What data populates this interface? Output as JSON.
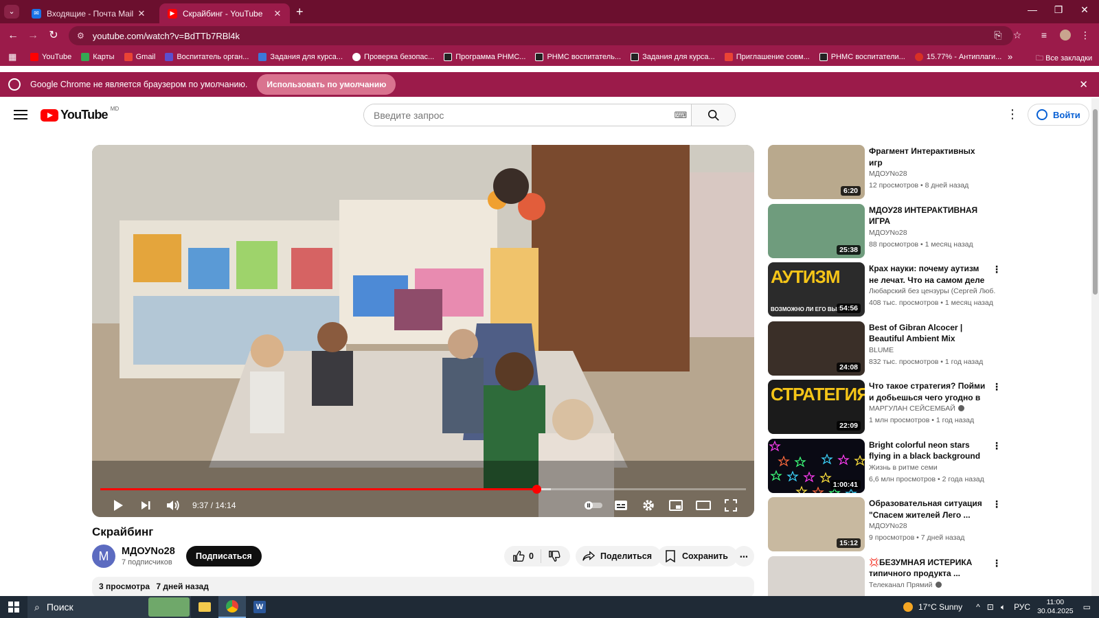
{
  "browser": {
    "tabs": [
      {
        "title": "Входящие - Почта Mail",
        "icon": "mail-icon",
        "active": false
      },
      {
        "title": "Скрайбинг - YouTube",
        "icon": "youtube-icon",
        "active": true
      }
    ],
    "url": "youtube.com/watch?v=BdTTb7RBl4k",
    "bookmarks": [
      {
        "label": "YouTube",
        "color": "#ff0000"
      },
      {
        "label": "Карты",
        "color": "#34a853"
      },
      {
        "label": "Gmail",
        "color": "#ea4335"
      },
      {
        "label": "Воспитатель орган...",
        "color": "#5b4fcf"
      },
      {
        "label": "Задания для курса...",
        "color": "#3c78d8"
      },
      {
        "label": "Проверка безопас...",
        "color": "#ffffff"
      },
      {
        "label": "Программа PHMC...",
        "color": "#222222"
      },
      {
        "label": "PHMC воспитатель...",
        "color": "#222222"
      },
      {
        "label": "Задания для курса...",
        "color": "#222222"
      },
      {
        "label": "Приглашение совм...",
        "color": "#ea4335"
      },
      {
        "label": "PHMC воспитатели...",
        "color": "#222222"
      },
      {
        "label": "15.77% - Антиплаги...",
        "color": "#d93025"
      }
    ],
    "bookmarks_all": "Все закладки",
    "infobar": {
      "text": "Google Chrome не является браузером по умолчанию.",
      "button": "Использовать по умолчанию"
    }
  },
  "youtube": {
    "logo_text": "YouTube",
    "logo_region": "MD",
    "search_placeholder": "Введите запрос",
    "signin_label": "Войти",
    "player": {
      "time": "9:37 / 14:14",
      "progress_played": 0.676,
      "progress_buffered": 0.698
    },
    "video": {
      "title": "Скрайбинг",
      "channel": "МДОУNo28",
      "channel_initial": "M",
      "subscribers": "7 подписчиков",
      "subscribe_label": "Подписаться",
      "likes": "0",
      "share_label": "Поделиться",
      "save_label": "Сохранить",
      "views": "3 просмотра",
      "date": "7 дней назад"
    },
    "recommendations": [
      {
        "title": "Фрагмент Интерактивных игр",
        "channel": "МДОУNo28",
        "meta": "12 просмотров • 8 дней назад",
        "duration": "6:20",
        "verified": false,
        "menu": false,
        "thumb": "#b9a98d"
      },
      {
        "title": "МДОУ28 ИНТЕРАКТИВНАЯ ИГРА",
        "channel": "МДОУNo28",
        "meta": "88 просмотров • 1 месяц назад",
        "duration": "25:38",
        "verified": false,
        "menu": false,
        "thumb": "#6f9c7d"
      },
      {
        "title": "Крах науки: почему аутизм не лечат. Что на самом деле ...",
        "channel": "Любарский без цензуры (Сергей Люб...",
        "meta": "408 тыс. просмотров • 1 месяц назад",
        "duration": "54:56",
        "verified": false,
        "menu": true,
        "thumb": "#2b2b2b",
        "overlay": "АУТИЗМ",
        "overlay_sub": "ВОЗМОЖНО ЛИ ЕГО ВЫЛ"
      },
      {
        "title": "Best of Gibran Alcocer | Beautiful Ambient Mix",
        "channel": "BLUME",
        "meta": "832 тыс. просмотров • 1 год назад",
        "duration": "24:08",
        "verified": false,
        "menu": false,
        "thumb": "#3a2f28"
      },
      {
        "title": "Что такое стратегия? Пойми и добьешься чего угодно в ...",
        "channel": "МАРГУЛАН СЕЙСЕМБАЙ",
        "meta": "1 млн просмотров • 1 год назад",
        "duration": "22:09",
        "verified": true,
        "menu": true,
        "thumb": "#1b1b1b",
        "overlay": "СТРАТЕГИЯ",
        "overlay_sub": ""
      },
      {
        "title": "Bright colorful neon stars flying in a black background",
        "channel": "Жизнь в ритме семи",
        "meta": "6,6 млн просмотров • 2 года назад",
        "duration": "1:00:41",
        "verified": false,
        "menu": true,
        "thumb": "#0a0a14"
      },
      {
        "title": "Образовательная ситуация \"Спасем жителей Лего ...",
        "channel": "МДОУNo28",
        "meta": "9 просмотров • 7 дней назад",
        "duration": "15:12",
        "verified": false,
        "menu": true,
        "thumb": "#c8b9a0"
      },
      {
        "title": "💢БЕЗУМНАЯ ИСТЕРИКА типичного продукта ...",
        "channel": "Телеканал Прямий",
        "meta": "",
        "duration": "",
        "verified": true,
        "menu": true,
        "thumb": "#d9d4cf"
      }
    ]
  },
  "taskbar": {
    "search_label": "Поиск",
    "weather": "17°C  Sunny",
    "lang": "РУС",
    "time": "11:00",
    "date": "30.04.2025"
  }
}
